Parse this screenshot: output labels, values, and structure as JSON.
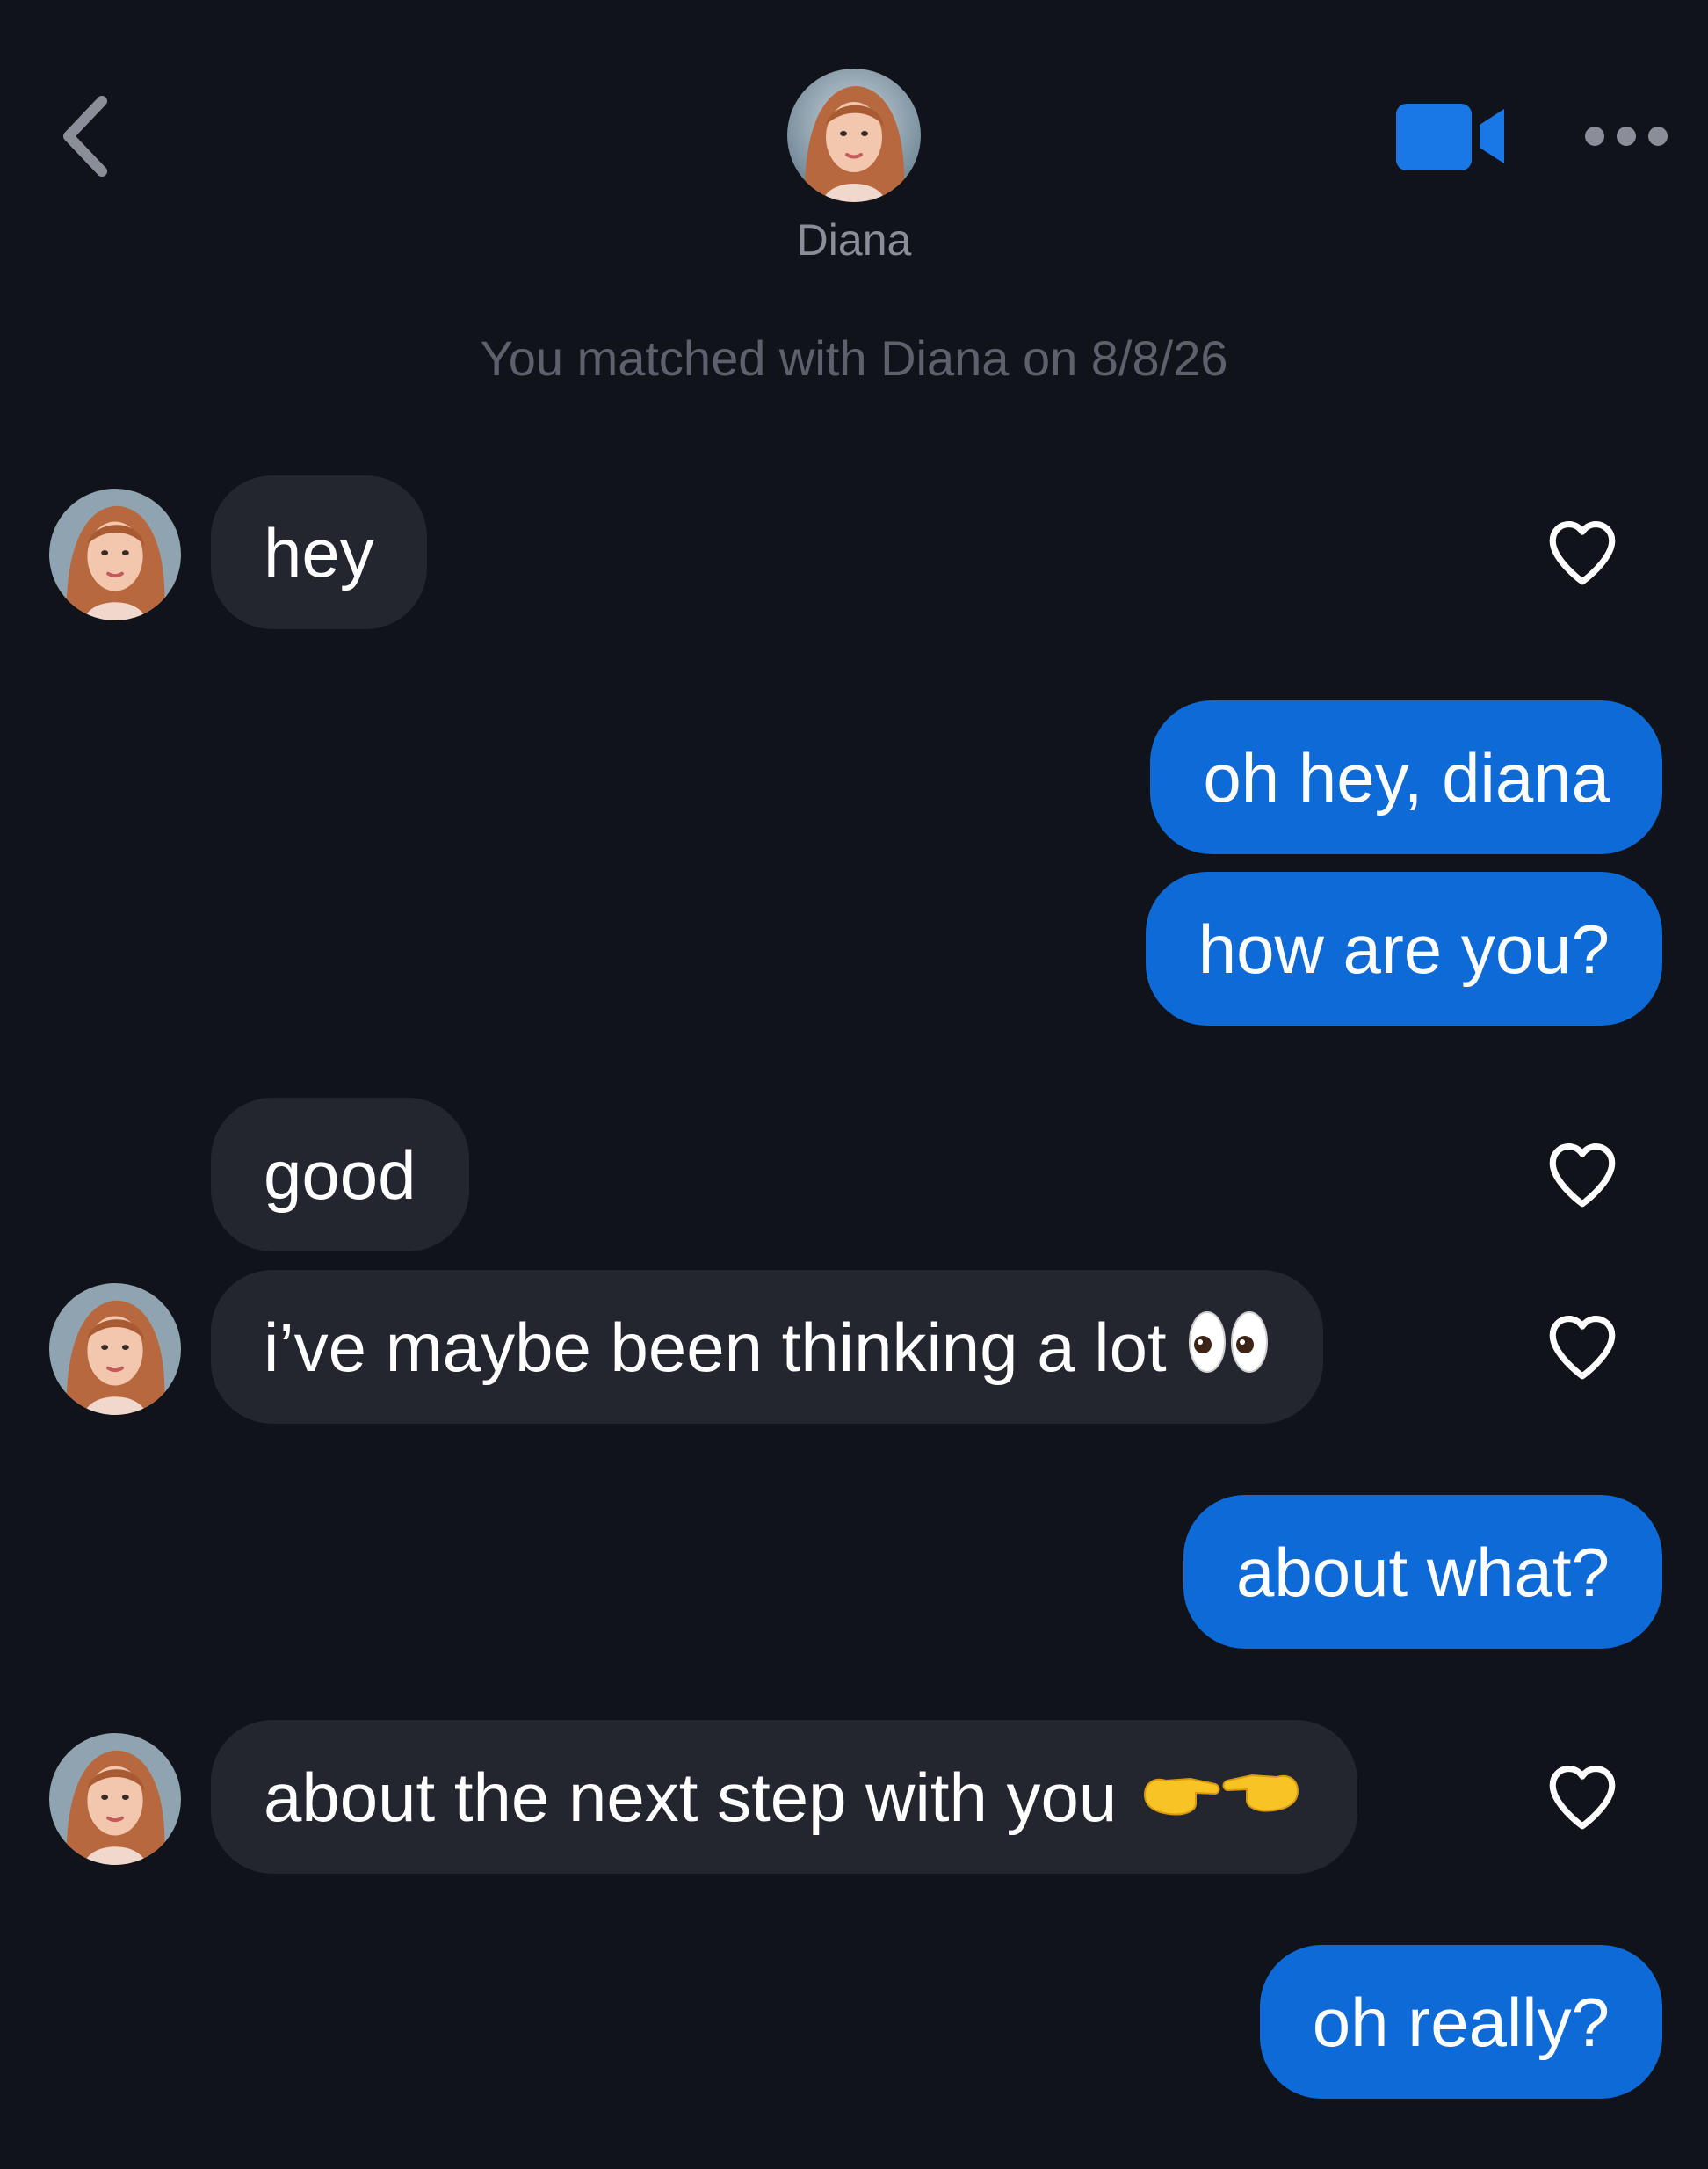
{
  "header": {
    "back_icon": "chevron-left-icon",
    "contact_name": "Diana",
    "video_icon": "video-camera-icon",
    "more_icon": "more-horizontal-icon",
    "accent_color": "#1a78e6"
  },
  "match_notice": "You matched with Diana on 8/8/26",
  "messages": [
    {
      "sender": "Diana",
      "text": "hey",
      "liked": false
    },
    {
      "sender": "me",
      "text": "oh hey, diana"
    },
    {
      "sender": "me",
      "text": "how are you?"
    },
    {
      "sender": "Diana",
      "text": "good",
      "liked": false
    },
    {
      "sender": "Diana",
      "text": "i’ve maybe been thinking a lot",
      "emoji": "eyes",
      "liked": false
    },
    {
      "sender": "me",
      "text": "about what?"
    },
    {
      "sender": "Diana",
      "text": "about the next step with you",
      "emoji": "pointing-fingers",
      "liked": false
    },
    {
      "sender": "me",
      "text": "oh really?"
    }
  ],
  "colors": {
    "background": "#11131a",
    "incoming_bubble": "#23262f",
    "outgoing_bubble": "#0e6ad6"
  }
}
